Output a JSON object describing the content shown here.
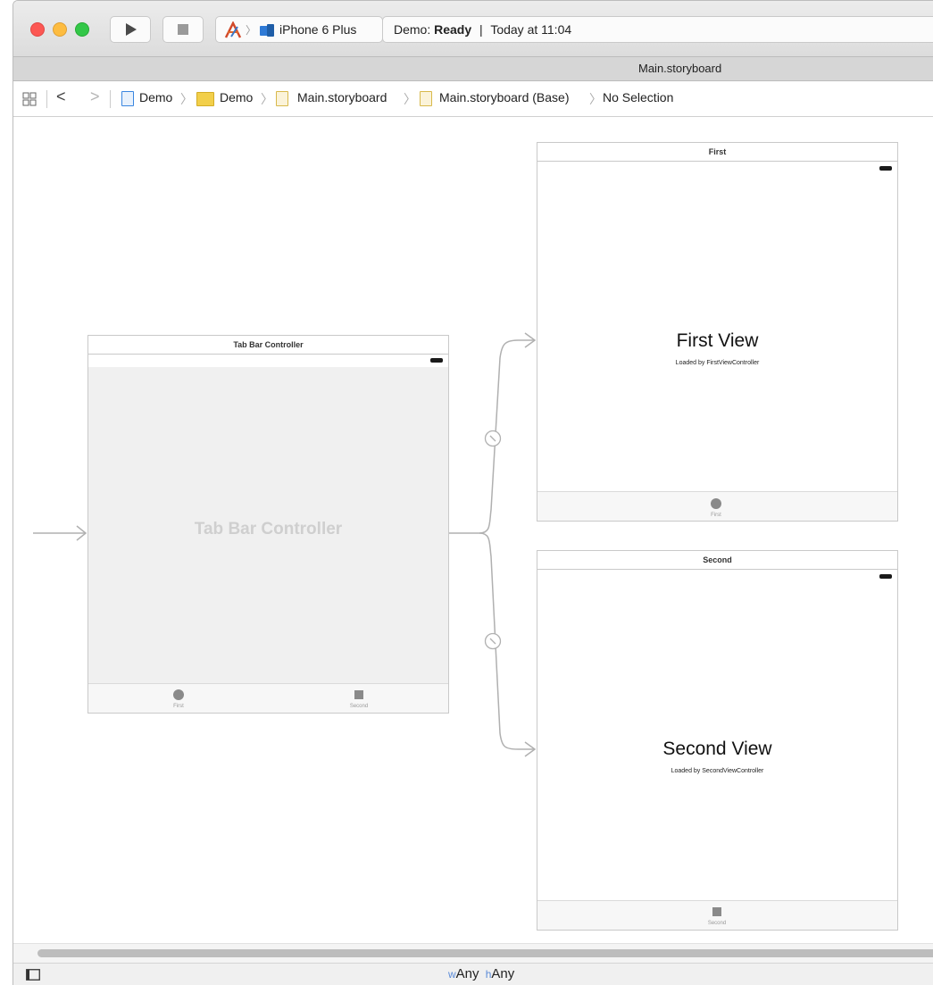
{
  "toolbar": {
    "run_button": "play-icon",
    "stop_button": "stop-icon",
    "scheme": {
      "project_icon": "xcode-app-icon",
      "device_icon": "iphone-device-icon",
      "device": "iPhone 6 Plus"
    },
    "status": {
      "project": "Demo:",
      "state": "Ready",
      "separator": "|",
      "time": "Today at 11:04"
    }
  },
  "tab": {
    "title": "Main.storyboard"
  },
  "jumpbar": {
    "items": [
      {
        "label": "Demo",
        "icon": "project-file-icon"
      },
      {
        "label": "Demo",
        "icon": "folder-icon"
      },
      {
        "label": "Main.storyboard",
        "icon": "storyboard-file-icon"
      },
      {
        "label": "Main.storyboard (Base)",
        "icon": "storyboard-file-icon"
      },
      {
        "label": "No Selection"
      }
    ]
  },
  "scenes": {
    "tab_bar": {
      "title": "Tab Bar Controller",
      "center_label": "Tab Bar Controller",
      "tab_items": [
        "First",
        "Second"
      ]
    },
    "first": {
      "title": "First",
      "heading": "First View",
      "subtitle": "Loaded by FirstViewController",
      "tab_item": "First"
    },
    "second": {
      "title": "Second",
      "heading": "Second View",
      "subtitle": "Loaded by SecondViewController",
      "tab_item": "Second"
    }
  },
  "bottombar": {
    "size_class": {
      "w_prefix": "w",
      "w_value": "Any",
      "h_prefix": "h",
      "h_value": "Any"
    }
  },
  "colors": {
    "close": "#fc5753",
    "minimize": "#fdbc40",
    "zoom": "#33c748",
    "segue": "#b0b0b0",
    "tab_bar_scene_bg": "#f0f0f0",
    "tab_bar_label": "#cfcfcf",
    "size_class_accent": "#5b8bd8"
  }
}
